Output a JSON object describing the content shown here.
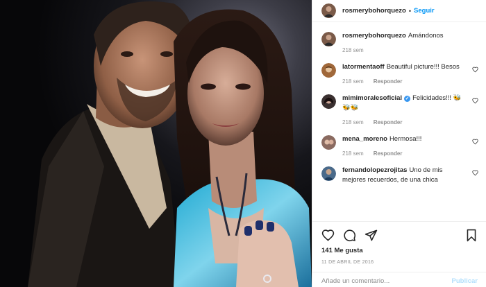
{
  "header": {
    "username": "rosmerybohorquezo",
    "separator": "•",
    "follow_label": "Seguir"
  },
  "comments": [
    {
      "username": "rosmerybohorquezo",
      "text": "Amándonos",
      "time": "218 sem",
      "reply": "",
      "verified": false,
      "avatar_color": "#7a5a48"
    },
    {
      "username": "latormentaoff",
      "text": "Beautiful picture!!! Besos",
      "time": "218 sem",
      "reply": "Responder",
      "verified": false,
      "avatar_color": "#a0683a"
    },
    {
      "username": "mimimoralesoficial",
      "text": "Felicidades!!! 🐝🐝🐝",
      "time": "218 sem",
      "reply": "Responder",
      "verified": true,
      "avatar_color": "#3a3030"
    },
    {
      "username": "mena_moreno",
      "text": "Hermosa!!!",
      "time": "218 sem",
      "reply": "Responder",
      "verified": false,
      "avatar_color": "#8a6a60"
    },
    {
      "username": "fernandolopezrojitas",
      "text": "Uno de mis mejores recuerdos, de una chica",
      "time": "",
      "reply": "",
      "verified": false,
      "avatar_color": "#4a6a8a"
    }
  ],
  "actions": {
    "likes": "141 Me gusta",
    "date": "11 DE ABRIL DE 2016"
  },
  "add_comment": {
    "placeholder": "Añade un comentario...",
    "publish_label": "Publicar"
  },
  "colors": {
    "link_blue": "#0095f6",
    "publish_disabled": "#b2dffc",
    "muted": "#8e8e8e",
    "text": "#262626"
  },
  "icons": [
    "heart-icon",
    "comment-icon",
    "share-icon",
    "bookmark-icon",
    "verified-badge-icon"
  ]
}
